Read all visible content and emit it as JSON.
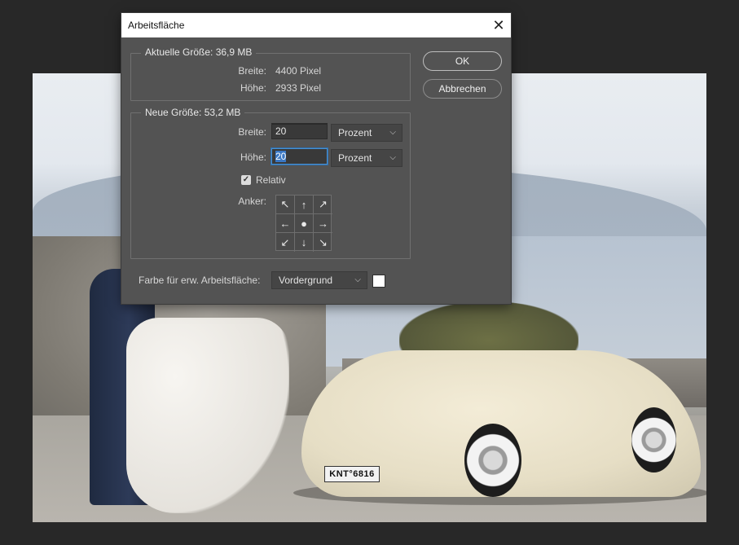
{
  "dialog": {
    "title": "Arbeitsfläche",
    "current_size": {
      "legend": "Aktuelle Größe: 36,9 MB",
      "width_label": "Breite:",
      "width_value": "4400 Pixel",
      "height_label": "Höhe:",
      "height_value": "2933 Pixel"
    },
    "new_size": {
      "legend": "Neue Größe: 53,2 MB",
      "width_label": "Breite:",
      "width_value": "20",
      "width_unit": "Prozent",
      "height_label": "Höhe:",
      "height_value": "20",
      "height_unit": "Prozent",
      "relative_label": "Relativ",
      "relative_checked": true,
      "anchor_label": "Anker:"
    },
    "extension_color": {
      "label": "Farbe für erw. Arbeitsfläche:",
      "value": "Vordergrund",
      "swatch_color": "#ffffff"
    },
    "buttons": {
      "ok": "OK",
      "cancel": "Abbrechen"
    }
  },
  "photo": {
    "license_plate": "KNT°6816"
  },
  "icons": {
    "close": "close-icon",
    "checkbox": "checkmark-icon",
    "chevron": "chevron-down-icon"
  }
}
